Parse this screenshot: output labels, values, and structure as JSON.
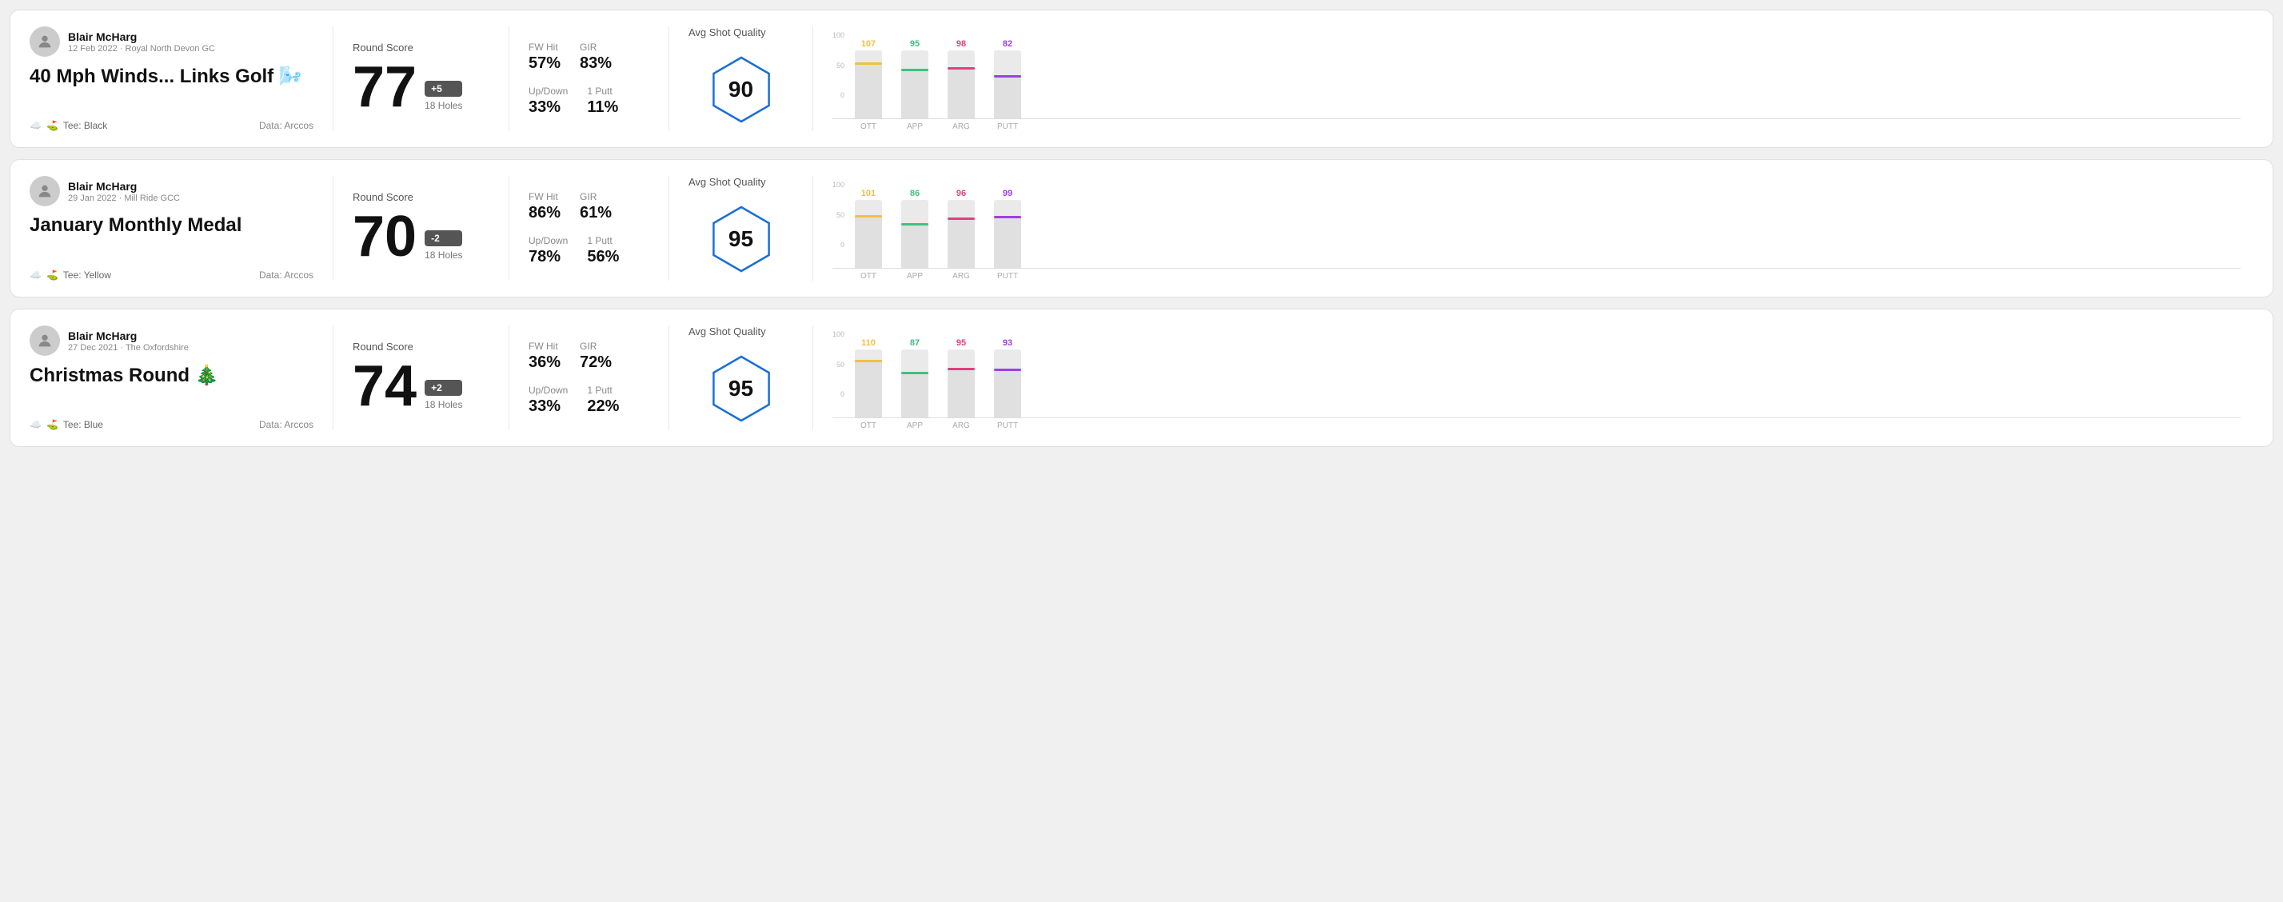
{
  "rounds": [
    {
      "id": "round-1",
      "player": "Blair McHarg",
      "date": "12 Feb 2022 · Royal North Devon GC",
      "title": "40 Mph Winds... Links Golf 🌬️",
      "tee": "Black",
      "data_source": "Data: Arccos",
      "round_score_label": "Round Score",
      "score": "77",
      "score_modifier": "+5",
      "holes": "18 Holes",
      "fw_hit": "57%",
      "gir": "83%",
      "up_down": "33%",
      "one_putt": "11%",
      "avg_quality_label": "Avg Shot Quality",
      "avg_quality_score": "90",
      "bars": [
        {
          "label": "OTT",
          "value": 107,
          "color": "#f0c040",
          "max": 130
        },
        {
          "label": "APP",
          "value": 95,
          "color": "#40c080",
          "max": 130
        },
        {
          "label": "ARG",
          "value": 98,
          "color": "#e04080",
          "max": 130
        },
        {
          "label": "PUTT",
          "value": 82,
          "color": "#a040e0",
          "max": 130
        }
      ]
    },
    {
      "id": "round-2",
      "player": "Blair McHarg",
      "date": "29 Jan 2022 · Mill Ride GCC",
      "title": "January Monthly Medal",
      "tee": "Yellow",
      "data_source": "Data: Arccos",
      "round_score_label": "Round Score",
      "score": "70",
      "score_modifier": "-2",
      "holes": "18 Holes",
      "fw_hit": "86%",
      "gir": "61%",
      "up_down": "78%",
      "one_putt": "56%",
      "avg_quality_label": "Avg Shot Quality",
      "avg_quality_score": "95",
      "bars": [
        {
          "label": "OTT",
          "value": 101,
          "color": "#f0c040",
          "max": 130
        },
        {
          "label": "APP",
          "value": 86,
          "color": "#40c080",
          "max": 130
        },
        {
          "label": "ARG",
          "value": 96,
          "color": "#e04080",
          "max": 130
        },
        {
          "label": "PUTT",
          "value": 99,
          "color": "#a040e0",
          "max": 130
        }
      ]
    },
    {
      "id": "round-3",
      "player": "Blair McHarg",
      "date": "27 Dec 2021 · The Oxfordshire",
      "title": "Christmas Round 🎄",
      "tee": "Blue",
      "data_source": "Data: Arccos",
      "round_score_label": "Round Score",
      "score": "74",
      "score_modifier": "+2",
      "holes": "18 Holes",
      "fw_hit": "36%",
      "gir": "72%",
      "up_down": "33%",
      "one_putt": "22%",
      "avg_quality_label": "Avg Shot Quality",
      "avg_quality_score": "95",
      "bars": [
        {
          "label": "OTT",
          "value": 110,
          "color": "#f0c040",
          "max": 130
        },
        {
          "label": "APP",
          "value": 87,
          "color": "#40c080",
          "max": 130
        },
        {
          "label": "ARG",
          "value": 95,
          "color": "#e04080",
          "max": 130
        },
        {
          "label": "PUTT",
          "value": 93,
          "color": "#a040e0",
          "max": 130
        }
      ]
    }
  ],
  "labels": {
    "fw_hit": "FW Hit",
    "gir": "GIR",
    "up_down": "Up/Down",
    "one_putt": "1 Putt"
  }
}
